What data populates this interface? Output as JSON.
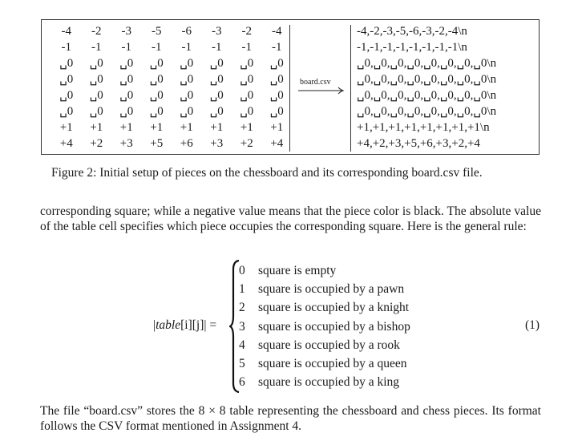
{
  "figure": {
    "board_table": [
      [
        "-4",
        "-2",
        "-3",
        "-5",
        "-6",
        "-3",
        "-2",
        "-4"
      ],
      [
        "-1",
        "-1",
        "-1",
        "-1",
        "-1",
        "-1",
        "-1",
        "-1"
      ],
      [
        "␣0",
        "␣0",
        "␣0",
        "␣0",
        "␣0",
        "␣0",
        "␣0",
        "␣0"
      ],
      [
        "␣0",
        "␣0",
        "␣0",
        "␣0",
        "␣0",
        "␣0",
        "␣0",
        "␣0"
      ],
      [
        "␣0",
        "␣0",
        "␣0",
        "␣0",
        "␣0",
        "␣0",
        "␣0",
        "␣0"
      ],
      [
        "␣0",
        "␣0",
        "␣0",
        "␣0",
        "␣0",
        "␣0",
        "␣0",
        "␣0"
      ],
      [
        "+1",
        "+1",
        "+1",
        "+1",
        "+1",
        "+1",
        "+1",
        "+1"
      ],
      [
        "+4",
        "+2",
        "+3",
        "+5",
        "+6",
        "+3",
        "+2",
        "+4"
      ]
    ],
    "arrow_label": "board.csv",
    "csv_lines": [
      "-4,-2,-3,-5,-6,-3,-2,-4\\n",
      "-1,-1,-1,-1,-1,-1,-1,-1\\n",
      "␣0,␣0,␣0,␣0,␣0,␣0,␣0,␣0\\n",
      "␣0,␣0,␣0,␣0,␣0,␣0,␣0,␣0\\n",
      "␣0,␣0,␣0,␣0,␣0,␣0,␣0,␣0\\n",
      "␣0,␣0,␣0,␣0,␣0,␣0,␣0,␣0\\n",
      "+1,+1,+1,+1,+1,+1,+1,+1\\n",
      "+4,+2,+3,+5,+6,+3,+2,+4"
    ],
    "caption": "Figure 2: Initial setup of pieces on the chessboard and its corresponding board.csv file."
  },
  "paragraph1": "corresponding square; while a negative value means that the piece color is black.  The absolute value of the table cell specifies which piece occupies the corresponding square. Here is the general rule:",
  "equation": {
    "lhs_pre": "|",
    "lhs_var": "table",
    "lhs_idx1": "[i]",
    "lhs_idx2": "[j]",
    "lhs_post": "| =",
    "cases": [
      {
        "value": "0",
        "text": "square is empty"
      },
      {
        "value": "1",
        "text": "square is occupied by a pawn"
      },
      {
        "value": "2",
        "text": "square is occupied by a knight"
      },
      {
        "value": "3",
        "text": "square is occupied by a bishop"
      },
      {
        "value": "4",
        "text": "square is occupied by a rook"
      },
      {
        "value": "5",
        "text": "square is occupied by a queen"
      },
      {
        "value": "6",
        "text": "square is occupied by a king"
      }
    ],
    "number": "(1)"
  },
  "paragraph2": "The file “board.csv” stores the 8 × 8 table representing the chessboard and chess pieces. Its format follows the CSV format mentioned in Assignment 4."
}
